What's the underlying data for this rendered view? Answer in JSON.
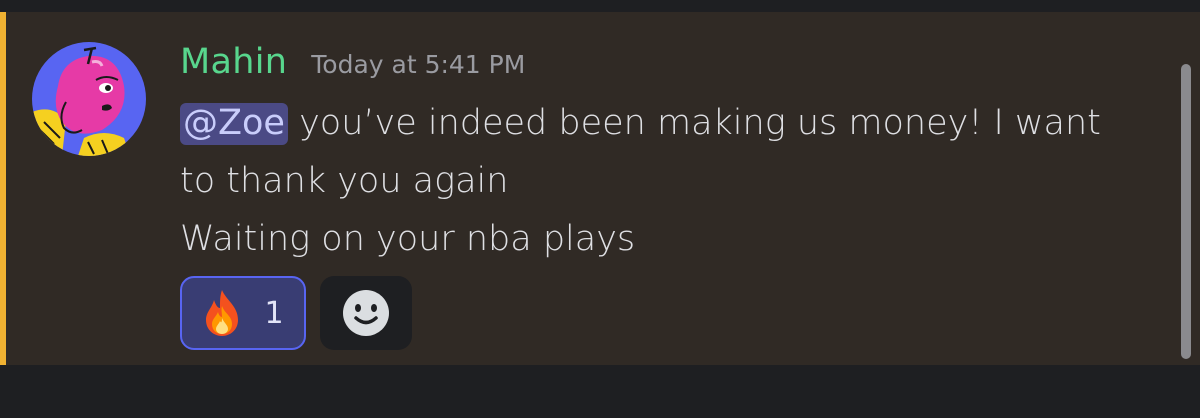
{
  "message": {
    "author": "Mahin",
    "timestamp": "Today at 5:41 PM",
    "mention": "@Zoe",
    "line1_rest": " you’ve indeed been making us money! I want",
    "line2": "to thank you again",
    "line3": "Waiting on your nba plays"
  },
  "reactions": [
    {
      "emoji_icon": "fire-icon",
      "count": "1"
    }
  ],
  "add_reaction_icon": "smiley-icon",
  "colors": {
    "message_bg": "#302a25",
    "mention_accent": "#f0b232",
    "username": "#58d68d",
    "mention_bg": "#4b4a85",
    "reaction_border": "#5865f2",
    "page_bg": "#1e1f22"
  }
}
